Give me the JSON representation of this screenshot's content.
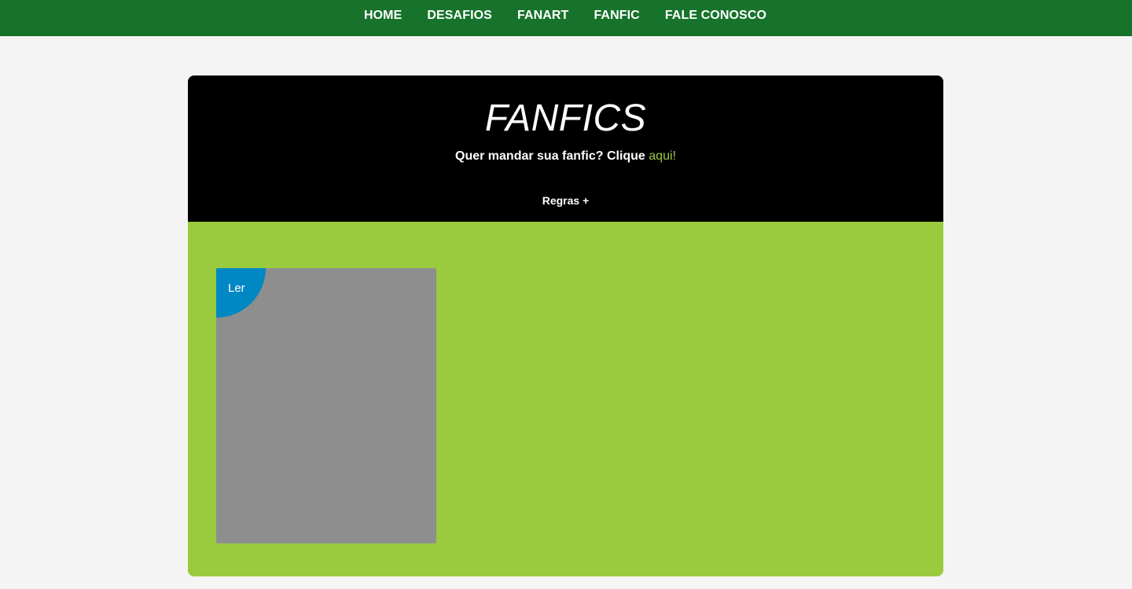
{
  "nav": {
    "items": [
      {
        "label": "HOME"
      },
      {
        "label": "DESAFIOS"
      },
      {
        "label": "FANART"
      },
      {
        "label": "FANFIC"
      },
      {
        "label": "FALE CONOSCO"
      }
    ]
  },
  "header": {
    "title": "FANFICS",
    "subtitle_text": "Quer mandar sua fanfic? Clique ",
    "subtitle_link": "aqui!",
    "rules_label": "Regras +"
  },
  "stories": [
    {
      "read_label": "Ler"
    }
  ],
  "colors": {
    "nav_bg": "#17732b",
    "page_bg": "#f4f4f4",
    "header_bg": "#000000",
    "content_bg": "#9aca3d",
    "link": "#9aca3d",
    "placeholder": "#8e8e8e",
    "badge": "#0088c4"
  }
}
